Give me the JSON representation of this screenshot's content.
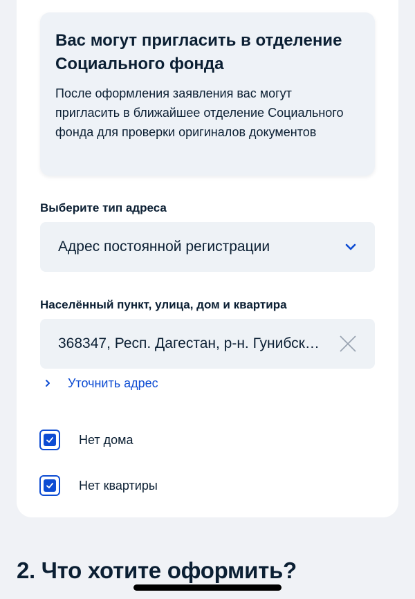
{
  "info_block": {
    "title": "Вас могут пригласить в отделение Социального фонда",
    "text": "После оформления заявления вас могут пригласить в ближайшее отделение Социального фонда для проверки оригиналов документов"
  },
  "address_type": {
    "label": "Выберите тип адреса",
    "selected": "Адрес постоянной регистрации",
    "icon": "chevron-down-icon"
  },
  "address": {
    "label": "Населённый пункт, улица, дом и квартира",
    "value": "368347, Респ. Дагестан, р-н. Гунибск…",
    "clear_icon": "close-icon",
    "refine_link": "Уточнить адрес"
  },
  "checkboxes": [
    {
      "label": "Нет дома",
      "checked": true
    },
    {
      "label": "Нет квартиры",
      "checked": true
    }
  ],
  "next_section": {
    "title": "2. Что хотите оформить?"
  },
  "colors": {
    "accent": "#0d4cd3",
    "text": "#0b1f33",
    "background": "#f0f2f6",
    "field_bg": "#eef2f6"
  }
}
